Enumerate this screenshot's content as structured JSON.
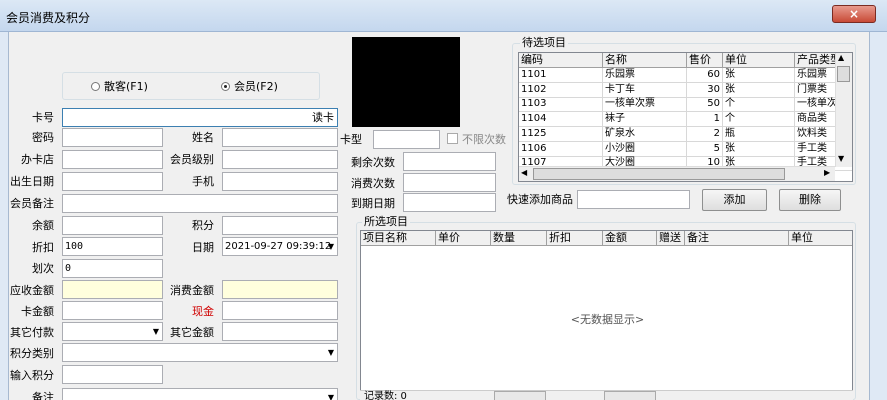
{
  "window": {
    "title": "会员消费及积分",
    "close": "×"
  },
  "radio": {
    "walkin": "散客(F1)",
    "member": "会员(F2)"
  },
  "labels": {
    "card_no": "卡号",
    "read_card": "读卡",
    "password": "密码",
    "name": "姓名",
    "card_type": "卡型",
    "unlimited": "不限次数",
    "issue_store": "办卡店",
    "member_level": "会员级别",
    "remaining_times": "剩余次数",
    "birth_date": "出生日期",
    "mobile": "手机",
    "consume_times": "消费次数",
    "member_note": "会员备注",
    "expire_date": "到期日期",
    "quick_add": "快速添加商品",
    "balance": "余额",
    "points": "积分",
    "discount": "折扣",
    "date": "日期",
    "deduct_times": "划次",
    "receivable": "应收金额",
    "consume_amount": "消费金额",
    "card_amount": "卡金额",
    "cash": "现金",
    "other_payment": "其它付款",
    "other_amount": "其它金额",
    "points_category": "积分类别",
    "input_points": "输入积分",
    "note": "备注"
  },
  "values": {
    "discount": "100",
    "date": "2021-09-27 09:39:12",
    "deduct_times": "0"
  },
  "buttons": {
    "add": "添加",
    "delete": "删除"
  },
  "candidates": {
    "title": "待选项目",
    "columns": [
      "编码",
      "名称",
      "售价",
      "单位",
      "产品类型"
    ],
    "rows": [
      [
        "1101",
        "乐园票",
        "60",
        "张",
        "乐园票"
      ],
      [
        "1102",
        "卡丁车",
        "30",
        "张",
        "门票类"
      ],
      [
        "1103",
        "一核单次票",
        "50",
        "个",
        "一核单次"
      ],
      [
        "1104",
        "袜子",
        "1",
        "个",
        "商品类"
      ],
      [
        "1125",
        "矿泉水",
        "2",
        "瓶",
        "饮料类"
      ],
      [
        "1106",
        "小沙圈",
        "5",
        "张",
        "手工类"
      ],
      [
        "1107",
        "大沙圈",
        "10",
        "张",
        "手工类"
      ]
    ]
  },
  "selected": {
    "title": "所选项目",
    "columns": [
      "项目名称",
      "单价",
      "数量",
      "折扣",
      "金额",
      "赠送",
      "备注",
      "单位"
    ],
    "empty": "<无数据显示>",
    "record_count": "记录数: 0"
  }
}
